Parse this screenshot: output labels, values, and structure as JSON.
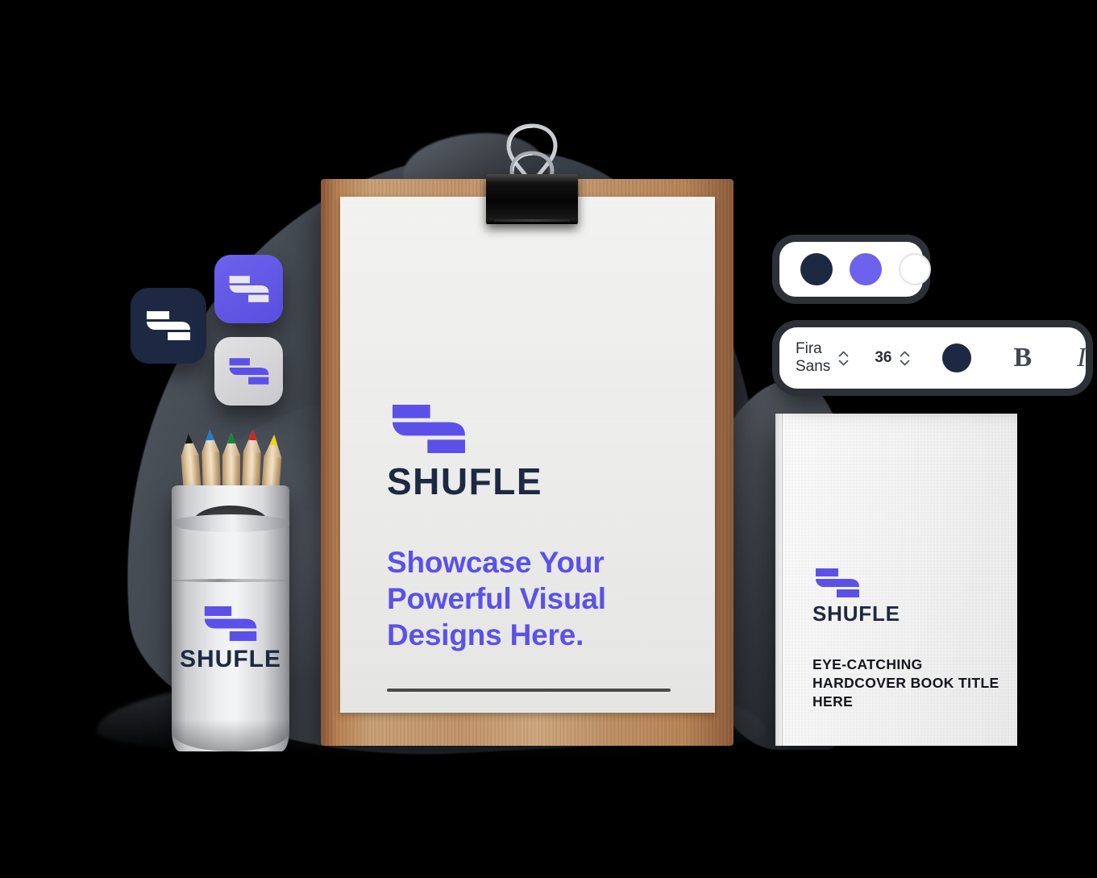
{
  "brand": {
    "name": "SHUFLE",
    "logo_icon": "shufle-logo-mark",
    "colors": {
      "primary_purple": "#5b51e8",
      "dark_navy": "#1d2942",
      "light_gray": "#d5d5d9",
      "white": "#ffffff"
    }
  },
  "poster": {
    "brand_name": "SHUFLE",
    "headline": "Showcase Your Powerful Visual Designs Here."
  },
  "book": {
    "brand_name": "SHUFLE",
    "title": "EYE-CATCHING HARDCOVER BOOK TITLE HERE"
  },
  "pencil_cup": {
    "brand_name": "SHUFLE",
    "pencil_colors": [
      "#151515",
      "#1a7fd4",
      "#118a35",
      "#d92121",
      "#f2d412"
    ]
  },
  "app_icons": [
    {
      "name": "app-icon-dark",
      "background": "#1d2942",
      "mark_color": "#ffffff"
    },
    {
      "name": "app-icon-purple",
      "background": "#6d62ec",
      "mark_color": "#e8e8ec"
    },
    {
      "name": "app-icon-light",
      "background": "#d8d8dc",
      "mark_color": "#5b51e8"
    }
  ],
  "swatch_panel": {
    "name": "color-swatch-panel",
    "swatches": [
      {
        "label": "dark-navy",
        "color": "#1d2942",
        "selected": true
      },
      {
        "label": "purple",
        "color": "#6d62ec",
        "selected": false
      },
      {
        "label": "white",
        "color": "#ffffff",
        "selected": false
      }
    ]
  },
  "type_panel": {
    "name": "typography-toolbar",
    "font_family": "Fira Sans",
    "font_size": "36",
    "text_color": "#1d2942",
    "bold_label": "B",
    "italic_label": "I"
  }
}
